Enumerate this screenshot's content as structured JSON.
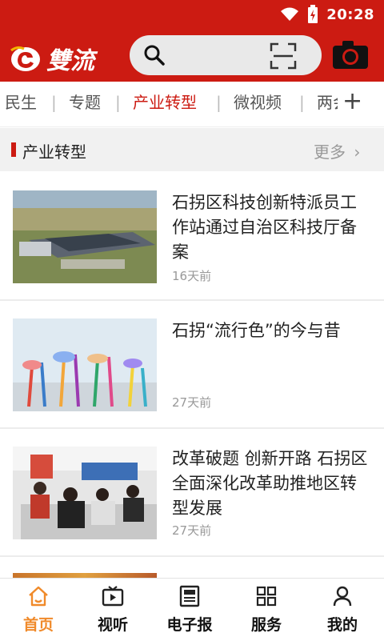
{
  "statusbar": {
    "time": "20:28"
  },
  "header": {
    "logo_text": "雙流",
    "icons": [
      "wifi-icon",
      "battery-icon",
      "search-icon",
      "scan-icon",
      "camera-icon"
    ]
  },
  "tabs": [
    {
      "label": "民生",
      "active": false
    },
    {
      "label": "专题",
      "active": false
    },
    {
      "label": "产业转型",
      "active": true
    },
    {
      "label": "微视频",
      "active": false
    },
    {
      "label": "两会",
      "active": false
    }
  ],
  "section": {
    "title": "产业转型",
    "more": "更多"
  },
  "news": [
    {
      "title": "石拐区科技创新特派员工作站通过自治区科技厅备案",
      "time": "16天前",
      "image": "industrial-park-aerial"
    },
    {
      "title": "石拐“流行色”的今与昔",
      "time": "27天前",
      "image": "colorful-tree-sculptures"
    },
    {
      "title": "改革破题 创新开路 石拐区全面深化改革助推地区转型发展",
      "time": "27天前",
      "image": "service-hall-meeting"
    }
  ],
  "bottom_nav": [
    {
      "label": "首页",
      "active": true,
      "icon": "home-icon"
    },
    {
      "label": "视听",
      "active": false,
      "icon": "tv-icon"
    },
    {
      "label": "电子报",
      "active": false,
      "icon": "newspaper-icon"
    },
    {
      "label": "服务",
      "active": false,
      "icon": "grid-icon"
    },
    {
      "label": "我的",
      "active": false,
      "icon": "user-icon"
    }
  ],
  "colors": {
    "brand_red": "#cc1b12",
    "active_orange": "#f08a2a"
  }
}
